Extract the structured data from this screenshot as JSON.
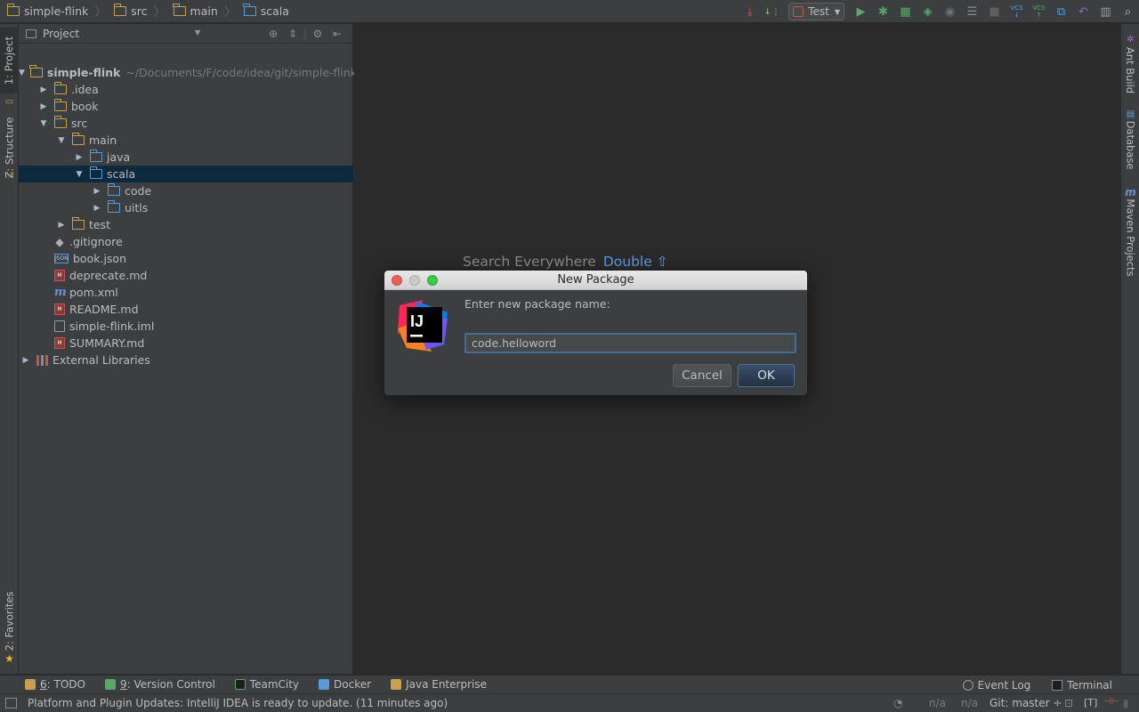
{
  "breadcrumb": [
    "simple-flink",
    "src",
    "main",
    "scala"
  ],
  "toolbar": {
    "run_config": "Test",
    "icons": [
      "make-icon",
      "sort-icon",
      "run-icon",
      "debug-icon",
      "coverage-icon",
      "profile-icon",
      "attach-icon",
      "build-icon",
      "stop-icon",
      "vcs-update-icon",
      "vcs-commit-icon",
      "compare-icon",
      "revert-icon",
      "structure-icon",
      "search-icon"
    ],
    "vcs_label": "VCS"
  },
  "left_tabs": {
    "project": "1: Project",
    "structure": "Z: Structure",
    "favorites": "2: Favorites"
  },
  "right_tabs": {
    "ant": "Ant Build",
    "database": "Database",
    "maven": "Maven Projects"
  },
  "project_panel": {
    "title": "Project",
    "tree": [
      {
        "label": "simple-flink",
        "path": "~/Documents/F/code/idea/git/simple-flink",
        "depth": 0,
        "arrow": "open",
        "icon": "module-folder",
        "bold": true
      },
      {
        "label": ".idea",
        "depth": 1,
        "arrow": "closed",
        "icon": "folder"
      },
      {
        "label": "book",
        "depth": 1,
        "arrow": "closed",
        "icon": "folder"
      },
      {
        "label": "src",
        "depth": 1,
        "arrow": "open",
        "icon": "folder"
      },
      {
        "label": "main",
        "depth": 2,
        "arrow": "open",
        "icon": "folder"
      },
      {
        "label": "java",
        "depth": 3,
        "arrow": "closed",
        "icon": "source-folder"
      },
      {
        "label": "scala",
        "depth": 3,
        "arrow": "open",
        "icon": "source-folder",
        "selected": true
      },
      {
        "label": "code",
        "depth": 4,
        "arrow": "closed",
        "icon": "package"
      },
      {
        "label": "uitls",
        "depth": 4,
        "arrow": "closed",
        "icon": "package"
      },
      {
        "label": "test",
        "depth": 2,
        "arrow": "closed",
        "icon": "folder"
      },
      {
        "label": ".gitignore",
        "depth": 1,
        "arrow": "none",
        "icon": "git"
      },
      {
        "label": "book.json",
        "depth": 1,
        "arrow": "none",
        "icon": "json"
      },
      {
        "label": "deprecate.md",
        "depth": 1,
        "arrow": "none",
        "icon": "md"
      },
      {
        "label": "pom.xml",
        "depth": 1,
        "arrow": "none",
        "icon": "maven"
      },
      {
        "label": "README.md",
        "depth": 1,
        "arrow": "none",
        "icon": "md"
      },
      {
        "label": "simple-flink.iml",
        "depth": 1,
        "arrow": "none",
        "icon": "file"
      },
      {
        "label": "SUMMARY.md",
        "depth": 1,
        "arrow": "none",
        "icon": "md"
      },
      {
        "label": "External Libraries",
        "depth": 0,
        "arrow": "closed",
        "icon": "library"
      }
    ]
  },
  "editor": {
    "search_label": "Search Everywhere",
    "search_key": "Double ⇧"
  },
  "dialog": {
    "title": "New Package",
    "label": "Enter new package name:",
    "input_value": "code.helloword",
    "cancel": "Cancel",
    "ok": "OK",
    "logo_text": "IJ"
  },
  "tool_windows": [
    {
      "num": "6",
      "label": ": TODO",
      "icon": "todo-icon"
    },
    {
      "num": "9",
      "label": ": Version Control",
      "icon": "version-control-icon"
    },
    {
      "num": "",
      "label": "TeamCity",
      "icon": "teamcity-icon"
    },
    {
      "num": "",
      "label": "Docker",
      "icon": "docker-icon"
    },
    {
      "num": "",
      "label": "Java Enterprise",
      "icon": "java-enterprise-icon"
    }
  ],
  "right_tool_windows": {
    "event_log": "Event Log",
    "terminal": "Terminal"
  },
  "status": {
    "message": "Platform and Plugin Updates: IntelliJ IDEA is ready to update. (11 minutes ago)",
    "na1": "n/a",
    "na2": "n/a",
    "git": "Git: master ÷"
  },
  "colors": {
    "accent": "#589df6",
    "selection": "#0d293e",
    "background": "#2b2b2b",
    "panel": "#3c3f41"
  }
}
